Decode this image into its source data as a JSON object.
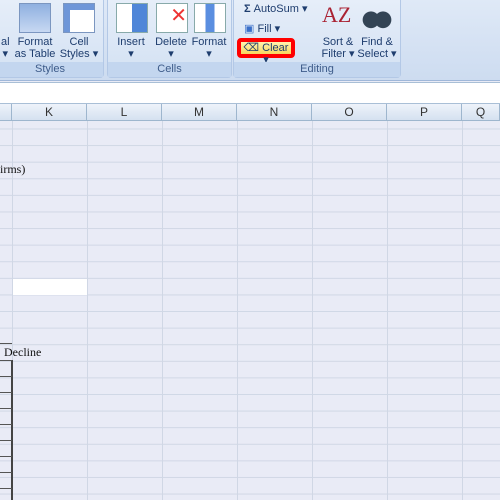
{
  "ribbon": {
    "styles": {
      "label": "Styles",
      "partial": "al",
      "format_table": [
        "Format",
        "as Table"
      ],
      "cell_styles": [
        "Cell",
        "Styles"
      ]
    },
    "cells": {
      "label": "Cells",
      "insert": "Insert",
      "delete": "Delete",
      "format": "Format"
    },
    "editing": {
      "label": "Editing",
      "autosum": "AutoSum",
      "fill": "Fill",
      "clear": "Clear",
      "sort": [
        "Sort &",
        "Filter"
      ],
      "find": [
        "Find &",
        "Select"
      ]
    },
    "highlight_color": "#ff0000"
  },
  "columns": [
    "K",
    "L",
    "M",
    "N",
    "O",
    "P",
    "Q"
  ],
  "cells": {
    "row_text_1": "irms)",
    "row_text_2": "Decline"
  }
}
